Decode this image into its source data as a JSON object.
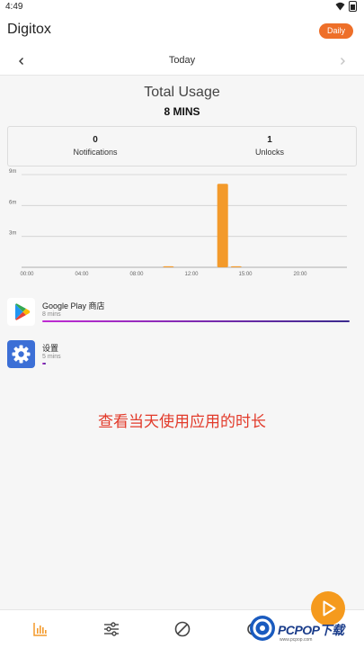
{
  "status_bar": {
    "time": "4:49"
  },
  "app_bar": {
    "title": "Digitox",
    "period": "Daily"
  },
  "date_nav": {
    "label": "Today"
  },
  "summary": {
    "title": "Total Usage",
    "value": "8 MINS"
  },
  "stats": {
    "notifications": {
      "value": "0",
      "label": "Notifications"
    },
    "unlocks": {
      "value": "1",
      "label": "Unlocks"
    }
  },
  "chart_data": {
    "type": "bar",
    "title": "",
    "xlabel": "",
    "ylabel": "",
    "x_tick_labels": [
      "00:00",
      "04:00",
      "08:00",
      "12:00",
      "15:00",
      "20:00"
    ],
    "y_tick_labels": [
      "9m",
      "6m",
      "3m"
    ],
    "ylim": [
      0,
      9
    ],
    "grid": true,
    "categories": [
      "00",
      "01",
      "02",
      "03",
      "04",
      "05",
      "06",
      "07",
      "08",
      "09",
      "10",
      "11",
      "12",
      "13",
      "14",
      "15",
      "16",
      "17",
      "18",
      "19",
      "20",
      "21",
      "22",
      "23"
    ],
    "values": [
      0,
      0,
      0,
      0,
      0,
      0,
      0,
      0,
      0,
      0,
      0.1,
      0,
      0,
      0,
      8.1,
      0.1,
      0,
      0,
      0,
      0,
      0,
      0,
      0,
      0
    ],
    "bar_color": "#f39a2b"
  },
  "apps": [
    {
      "name": "Google Play 商店",
      "time": "8 mins",
      "share": 1.0,
      "icon": "google-play-icon"
    },
    {
      "name": "设置",
      "time": "5 mins",
      "share": 0.012,
      "icon": "settings-gear-icon"
    }
  ],
  "caption": "查看当天使用应用的时长",
  "watermark": {
    "brand": "PCPOP下载",
    "sub": "www.pcpop.com"
  },
  "colors": {
    "accent": "#ee6f29",
    "fab": "#f59a1d",
    "bar": "#f39a2b",
    "caption": "#e23a2a"
  }
}
